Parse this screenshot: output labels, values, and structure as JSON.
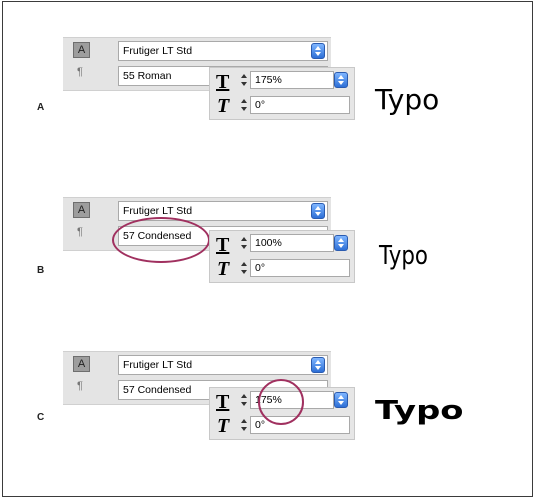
{
  "panels": [
    {
      "label": "A",
      "font_family": "Frutiger LT Std",
      "font_style": "55 Roman",
      "horizontal_scale": "175%",
      "skew": "0°",
      "sample_text": "Typo"
    },
    {
      "label": "B",
      "font_family": "Frutiger LT Std",
      "font_style": "57 Condensed",
      "horizontal_scale": "100%",
      "skew": "0°",
      "sample_text": "Typo"
    },
    {
      "label": "C",
      "font_family": "Frutiger LT Std",
      "font_style": "57 Condensed",
      "horizontal_scale": "175%",
      "skew": "0°",
      "sample_text": "Typo"
    }
  ],
  "icons": {
    "character_tool": "A",
    "paragraph_tool": "¶",
    "horizontal_scale_icon": "T",
    "skew_icon": "T"
  },
  "colors": {
    "highlight_circle": "#a0305f",
    "stepper_blue": "#2d6fd6"
  }
}
